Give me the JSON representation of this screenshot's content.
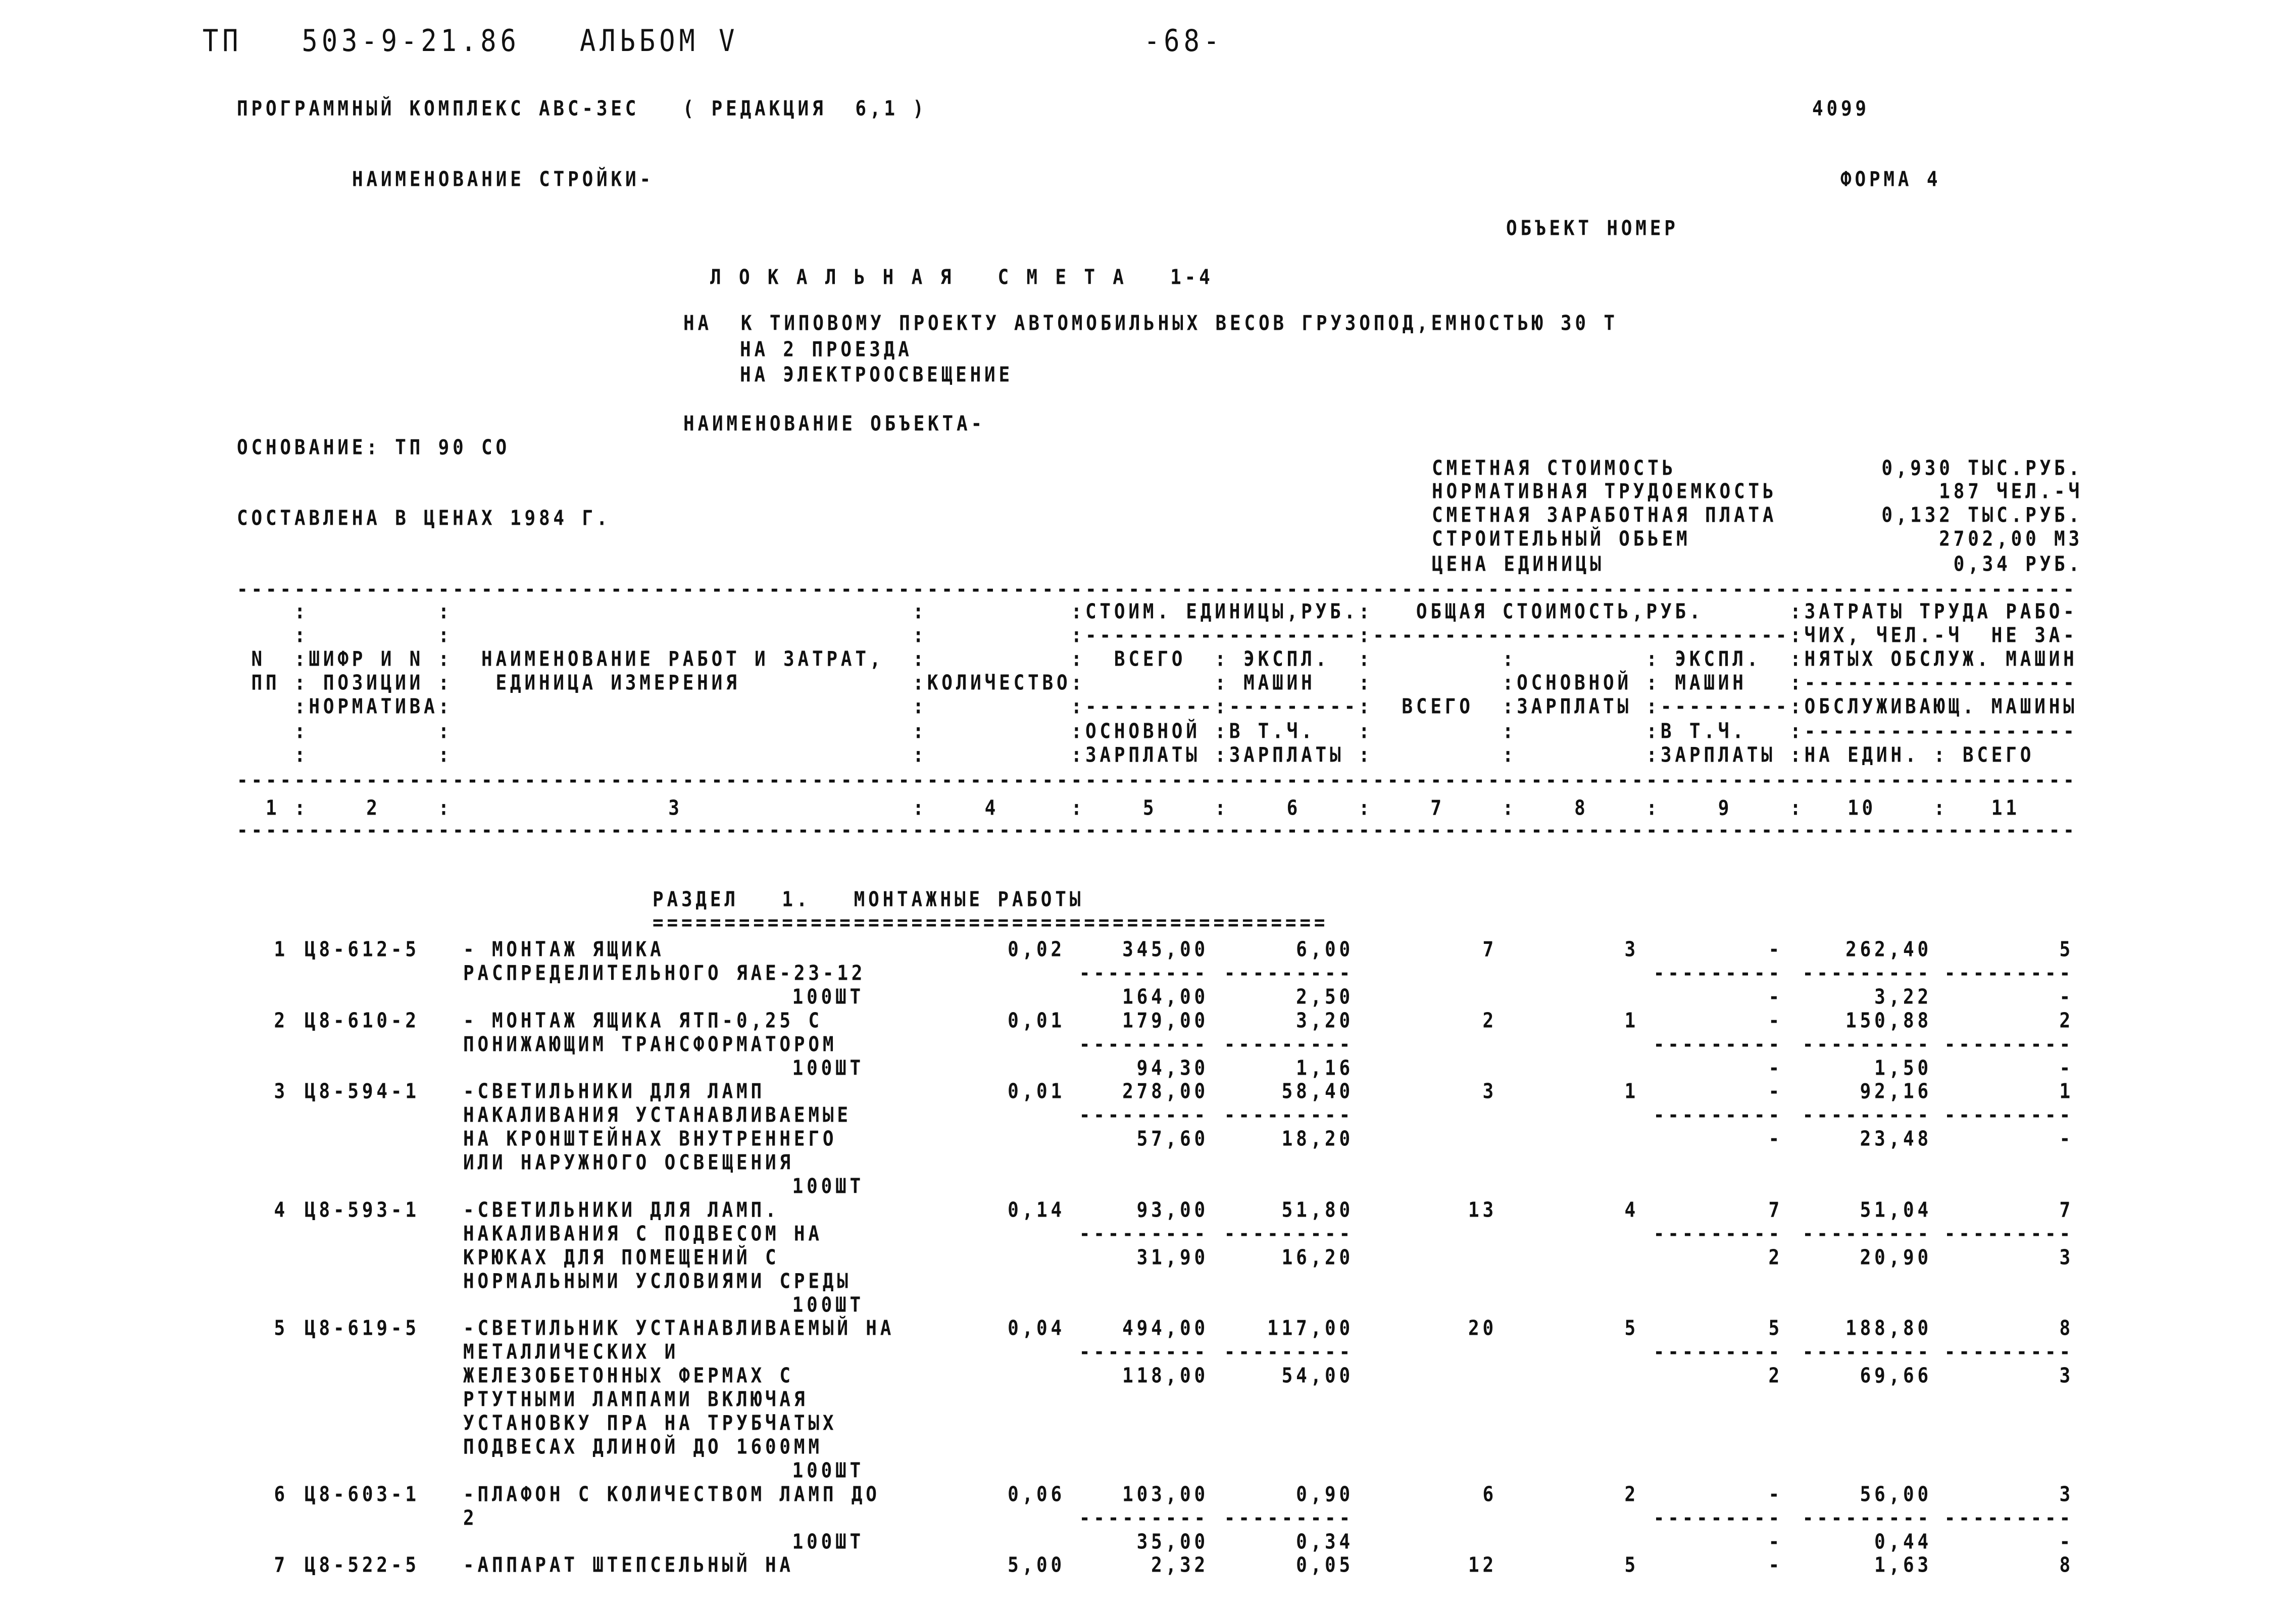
{
  "page_header": {
    "project": "ТП   503-9-21.86",
    "album": "АЛЬБОМ V",
    "page_number": "-68-"
  },
  "program": "ПРОГРАММНЫЙ КОМПЛЕКС АВС-3ЕС   ( РЕДАКЦИЯ  6,1 )",
  "doc_number": "4099",
  "construction_name_label": "НАИМЕНОВАНИЕ СТРОЙКИ-",
  "form": "ФОРМА 4",
  "object_number_label": "ОБЪЕКТ НОМЕР",
  "title": "Л О К А Л Ь Н А Я   С М Е Т А   1-4",
  "subtitle": [
    "НА  К ТИПОВОМУ ПРОЕКТУ АВТОМОБИЛЬНЫХ ВЕСОВ ГРУЗОПОД,ЕМНОСТЬЮ 30 Т",
    "НА 2 ПРОЕЗДА",
    "НА ЭЛЕКТРООСВЕЩЕНИЕ"
  ],
  "object_name_label": "НАИМЕНОВАНИЕ ОБЪЕКТА-",
  "basis": "ОСНОВАНИЕ: ТП 90 СО",
  "prices_year": "СОСТАВЛЕНА В ЦЕНАХ 1984 Г.",
  "summary": [
    {
      "label": "СМЕТНАЯ СТОИМОСТЬ",
      "value": "0,930 ТЫС.РУБ."
    },
    {
      "label": "НОРМАТИВНАЯ ТРУДОЕМКОСТЬ",
      "value": "187 ЧЕЛ.-Ч"
    },
    {
      "label": "СМЕТНАЯ ЗАРАБОТНАЯ ПЛАТА",
      "value": "0,132 ТЫС.РУБ."
    },
    {
      "label": "СТРОИТЕЛЬНЫЙ ОБЬЕМ",
      "value": "2702,00 М3"
    },
    {
      "label": "ЦЕНА ЕДИНИЦЫ",
      "value": "0,34 РУБ."
    }
  ],
  "table_header_lines": [
    "    :         :                                :          :СТОИМ. ЕДИНИЦЫ,РУБ.:   ОБЩАЯ СТОИМОСТЬ,РУБ.      :ЗАТРАТЫ ТРУДА РАБО-",
    "    :         :                                :          :-------------------:-----------------------------:ЧИХ, ЧЕЛ.-Ч  НЕ ЗА-",
    " N  :ШИФР И N :  НАИМЕНОВАНИЕ РАБОТ И ЗАТРАТ,  :          :  ВСЕГО  : ЭКСПЛ.  :         :         : ЭКСПЛ.  :НЯТЫХ ОБСЛУЖ. МАШИН",
    " ПП : ПОЗИЦИИ :   ЕДИНИЦА ИЗМЕРЕНИЯ            :КОЛИЧЕСТВО:         : МАШИН   :         :ОСНОВНОЙ : МАШИН   :-------------------",
    "    :НОРМАТИВА:                                :          :---------:---------:  ВСЕГО  :ЗАРПЛАТЫ :---------:ОБСЛУЖИВАЮЩ. МАШИНЫ",
    "    :         :                                :          :ОСНОВНОЙ :В Т.Ч.   :         :         :В Т.Ч.   :-------------------",
    "    :         :                                :          :ЗАРПЛАТЫ :ЗАРПЛАТЫ :         :         :ЗАРПЛАТЫ :НА ЕДИН. : ВСЕГО"
  ],
  "column_numbers_line": "  1 :    2    :               3                :    4     :    5    :    6    :    7    :    8    :    9    :   10    :   11",
  "rule_dash": "--------------------------------------------------------------------------------------------------------------------------------",
  "section": {
    "title": "РАЗДЕЛ   1.   МОНТАЖНЫЕ РАБОТЫ",
    "underline": "==============================================="
  },
  "sub_dash": "---------",
  "items": [
    {
      "n": "1",
      "code": "Ц8-612-5",
      "desc": [
        "- МОНТАЖ ЯЩИКА",
        "РАСПРЕДЕЛИТЕЛЬНОГО ЯАЕ-23-12"
      ],
      "unit": "100ШТ",
      "qty": "0,02",
      "unit_total": "345,00",
      "unit_mach": "6,00",
      "unit_wage": "164,00",
      "unit_mach_wage": "2,50",
      "total": "7",
      "wage": "3",
      "mach": "-",
      "mach_wage": "-",
      "labor_unit": "262,40",
      "labor_total": "5",
      "serv_unit": "3,22",
      "serv_total": "-"
    },
    {
      "n": "2",
      "code": "Ц8-610-2",
      "desc": [
        "- МОНТАЖ ЯЩИКА ЯТП-0,25 С",
        "ПОНИЖАЮЩИМ ТРАНСФОРМАТОРОМ"
      ],
      "unit": "100ШТ",
      "qty": "0,01",
      "unit_total": "179,00",
      "unit_mach": "3,20",
      "unit_wage": "94,30",
      "unit_mach_wage": "1,16",
      "total": "2",
      "wage": "1",
      "mach": "-",
      "mach_wage": "-",
      "labor_unit": "150,88",
      "labor_total": "2",
      "serv_unit": "1,50",
      "serv_total": "-"
    },
    {
      "n": "3",
      "code": "Ц8-594-1",
      "desc": [
        "-СВЕТИЛЬНИКИ ДЛЯ ЛАМП",
        "НАКАЛИВАНИЯ УСТАНАВЛИВАЕМЫЕ",
        "НА КРОНШТЕЙНАХ ВНУТРЕННЕГО",
        "ИЛИ НАРУЖНОГО ОСВЕЩЕНИЯ"
      ],
      "unit": "100ШТ",
      "qty": "0,01",
      "unit_total": "278,00",
      "unit_mach": "58,40",
      "unit_wage": "57,60",
      "unit_mach_wage": "18,20",
      "total": "3",
      "wage": "1",
      "mach": "-",
      "mach_wage": "-",
      "labor_unit": "92,16",
      "labor_total": "1",
      "serv_unit": "23,48",
      "serv_total": "-"
    },
    {
      "n": "4",
      "code": "Ц8-593-1",
      "desc": [
        "-СВЕТИЛЬНИКИ ДЛЯ ЛАМП.",
        "НАКАЛИВАНИЯ С ПОДВЕСОМ НА",
        "КРЮКАХ ДЛЯ ПОМЕЩЕНИЙ С",
        "НОРМАЛЬНЫМИ УСЛОВИЯМИ СРЕДЫ"
      ],
      "unit": "100ШТ",
      "qty": "0,14",
      "unit_total": "93,00",
      "unit_mach": "51,80",
      "unit_wage": "31,90",
      "unit_mach_wage": "16,20",
      "total": "13",
      "wage": "4",
      "mach": "7",
      "mach_wage": "2",
      "labor_unit": "51,04",
      "labor_total": "7",
      "serv_unit": "20,90",
      "serv_total": "3"
    },
    {
      "n": "5",
      "code": "Ц8-619-5",
      "desc": [
        "-СВЕТИЛЬНИК УСТАНАВЛИВАЕМЫЙ НА",
        "МЕТАЛЛИЧЕСКИХ И",
        "ЖЕЛЕЗОБЕТОННЫХ ФЕРМАХ С",
        "РТУТНЫМИ ЛАМПАМИ ВКЛЮЧАЯ",
        "УСТАНОВКУ ПРА НА ТРУБЧАТЫХ",
        "ПОДВЕСАХ ДЛИНОЙ ДО 1600ММ"
      ],
      "unit": "100ШТ",
      "qty": "0,04",
      "unit_total": "494,00",
      "unit_mach": "117,00",
      "unit_wage": "118,00",
      "unit_mach_wage": "54,00",
      "total": "20",
      "wage": "5",
      "mach": "5",
      "mach_wage": "2",
      "labor_unit": "188,80",
      "labor_total": "8",
      "serv_unit": "69,66",
      "serv_total": "3"
    },
    {
      "n": "6",
      "code": "Ц8-603-1",
      "desc": [
        "-ПЛАФОН С КОЛИЧЕСТВОМ ЛАМП ДО",
        "2"
      ],
      "unit": "100ШТ",
      "qty": "0,06",
      "unit_total": "103,00",
      "unit_mach": "0,90",
      "unit_wage": "35,00",
      "unit_mach_wage": "0,34",
      "total": "6",
      "wage": "2",
      "mach": "-",
      "mach_wage": "-",
      "labor_unit": "56,00",
      "labor_total": "3",
      "serv_unit": "0,44",
      "serv_total": "-"
    },
    {
      "n": "7",
      "code": "Ц8-522-5",
      "desc": [
        "-АППАРАТ ШТЕПСЕЛЬНЫЙ НА"
      ],
      "unit": null,
      "partial": true,
      "qty": "5,00",
      "unit_total": "2,32",
      "unit_mach": "0,05",
      "total": "12",
      "wage": "5",
      "mach": "-",
      "labor_unit": "1,63",
      "labor_total": "8"
    }
  ]
}
